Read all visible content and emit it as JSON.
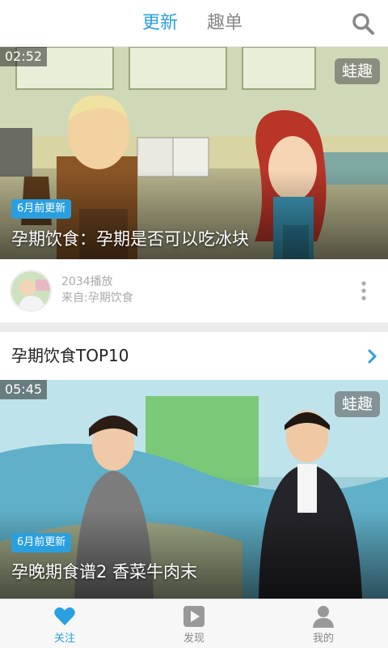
{
  "header": {
    "tabs": [
      {
        "label": "更新",
        "active": true
      },
      {
        "label": "趣单",
        "active": false
      }
    ],
    "search_icon": "search-icon"
  },
  "feed": {
    "cards": [
      {
        "duration": "02:52",
        "watermark": "蛙趣",
        "badge": "6月前更新",
        "title": "孕期饮食：孕期是否可以吃冰块",
        "plays": "2034播放",
        "source": "来自:孕期饮食"
      },
      {
        "duration": "05:45",
        "watermark": "蛙趣",
        "badge": "6月前更新",
        "title": "孕晚期食谱2 香菜牛肉末"
      }
    ],
    "section": {
      "title": "孕期饮食TOP10"
    }
  },
  "nav": {
    "items": [
      {
        "label": "关注",
        "icon": "heart-icon",
        "active": true
      },
      {
        "label": "发现",
        "icon": "play-icon",
        "active": false
      },
      {
        "label": "我的",
        "icon": "user-icon",
        "active": false
      }
    ]
  },
  "colors": {
    "accent": "#2a9fe0",
    "inactive": "#888888",
    "background": "#ececec"
  }
}
